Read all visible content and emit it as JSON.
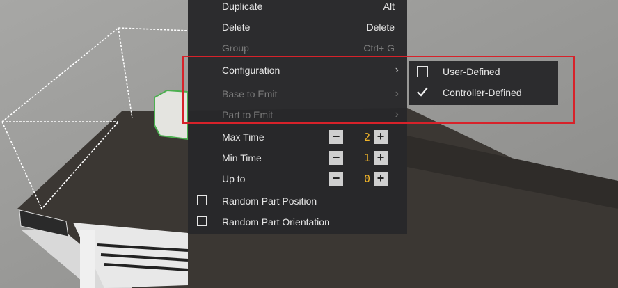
{
  "menu": {
    "items": [
      {
        "label": "Duplicate",
        "shortcut": "Alt",
        "disabled": false
      },
      {
        "label": "Delete",
        "shortcut": "Delete",
        "disabled": false
      },
      {
        "label": "Group",
        "shortcut": "Ctrl+ G",
        "disabled": true
      },
      {
        "label": "Configuration",
        "has_submenu": true,
        "disabled": false
      },
      {
        "label": "Base to Emit",
        "has_submenu": true,
        "disabled": true
      },
      {
        "label": "Part to Emit",
        "has_submenu": true,
        "disabled": true
      }
    ],
    "steppers": [
      {
        "label": "Max Time",
        "value": "2"
      },
      {
        "label": "Min Time",
        "value": "1"
      },
      {
        "label": "Up to",
        "value": "0"
      }
    ],
    "checkboxes": [
      {
        "label": "Random Part Position",
        "checked": false
      },
      {
        "label": "Random Part Orientation",
        "checked": false
      }
    ]
  },
  "submenu": {
    "items": [
      {
        "label": "User-Defined",
        "checked": false
      },
      {
        "label": "Controller-Defined",
        "checked": true
      }
    ]
  },
  "colors": {
    "menu_bg": "#28282a",
    "digit": "#f0b429",
    "highlight": "#d7222a"
  }
}
